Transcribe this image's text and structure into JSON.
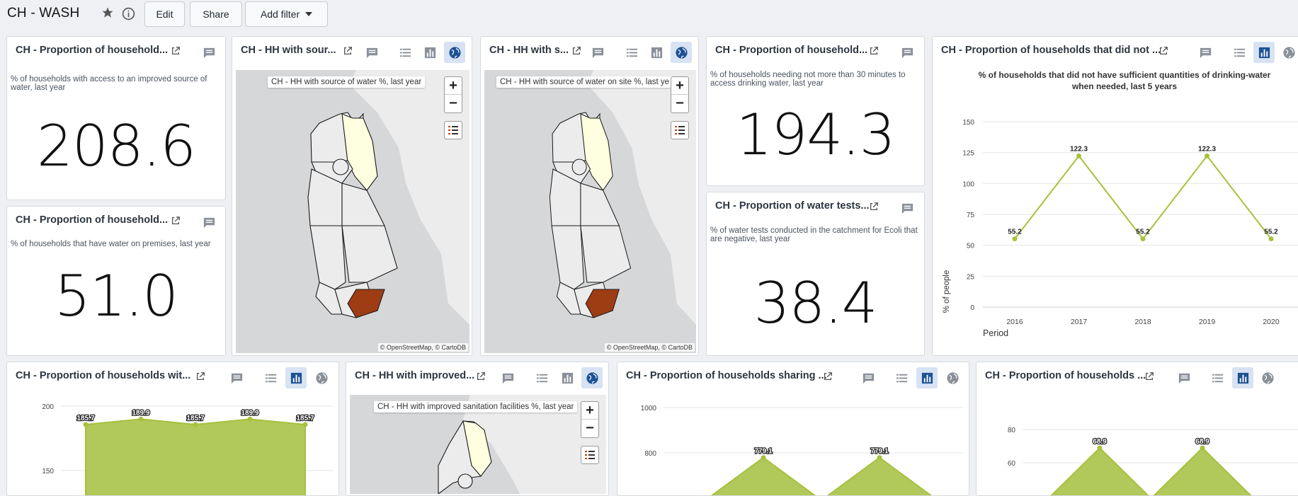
{
  "header": {
    "title": "CH - WASH",
    "edit_label": "Edit",
    "share_label": "Share",
    "add_filter_label": "Add filter"
  },
  "cards": {
    "improved_source": {
      "title": "CH - Proportion of household...",
      "subtitle": "% of households with access to an improved source of water, last year",
      "value": "208.6"
    },
    "water_premises": {
      "title": "CH - Proportion of household...",
      "subtitle": "% of households that have water on premises, last year",
      "value": "51.0"
    },
    "map_source": {
      "title": "CH - HH with sour...",
      "map_label": "CH - HH with source of water %, last year",
      "attribution": "© OpenStreetMap, © CartoDB"
    },
    "map_onsite": {
      "title": "CH - HH with s...",
      "map_label": "CH - HH with source of water on site %, last ye",
      "attribution": "© OpenStreetMap, © CartoDB"
    },
    "thirty_min": {
      "title": "CH - Proportion of household...",
      "subtitle": "% of households needing not more than 30 minutes to access drinking water, last year",
      "value": "194.3"
    },
    "water_tests": {
      "title": "CH - Proportion of water tests...",
      "subtitle": "% of water tests conducted in the catchment for Ecoli that are negative, last year",
      "value": "38.4"
    },
    "insufficient": {
      "title": "CH - Proportion of households that did not ...",
      "chart_title_line1": "% of households that did not have sufficient quantities of drinking-water",
      "chart_title_line2": "when needed, last 5 years",
      "ylabel": "% of people",
      "xlabel": "Period"
    },
    "bottom1": {
      "title": "CH - Proportion of households wit..."
    },
    "bottom2": {
      "title": "CH - HH with improved...",
      "map_label": "CH - HH with improved sanitation facilities %, last year"
    },
    "bottom3": {
      "title": "CH - Proportion of households sharing ..."
    },
    "bottom4": {
      "title": "CH - Proportion of households ..."
    }
  },
  "icons": {
    "star": "star-icon",
    "info": "info-icon",
    "external": "external-link-icon",
    "comment": "comment-icon",
    "table": "table-icon",
    "chart": "bar-chart-icon",
    "map": "globe-icon"
  },
  "colors": {
    "series": "#a6c13c",
    "area": "#b1c95a",
    "active_icon_bg": "#d7e3f3",
    "active_icon": "#1d5295",
    "map_high": "#9e3c14",
    "map_mid": "#fefee0"
  },
  "chart_data": [
    {
      "id": "insufficient",
      "type": "line",
      "categories": [
        "2016",
        "2017",
        "2018",
        "2019",
        "2020"
      ],
      "series": [
        {
          "values": [
            55.2,
            122.3,
            55.2,
            122.3,
            55.2
          ]
        }
      ],
      "yticks": [
        "0",
        "25",
        "50",
        "75",
        "100",
        "125",
        "150"
      ],
      "ylim": [
        0,
        150
      ],
      "grid": true
    },
    {
      "id": "bottom1",
      "type": "area",
      "series": [
        {
          "values": [
            185.7,
            189.9,
            185.7,
            189.9,
            185.7
          ]
        }
      ],
      "yticks": [
        "150",
        "200"
      ],
      "grid": true
    },
    {
      "id": "bottom3",
      "type": "area",
      "series": [
        {
          "values": [
            779.1,
            779.1
          ]
        }
      ],
      "yticks": [
        "800",
        "1000"
      ],
      "grid": true
    },
    {
      "id": "bottom4",
      "type": "area",
      "series": [
        {
          "values": [
            68.9,
            68.9
          ]
        }
      ],
      "yticks": [
        "60",
        "80"
      ],
      "grid": true
    }
  ]
}
